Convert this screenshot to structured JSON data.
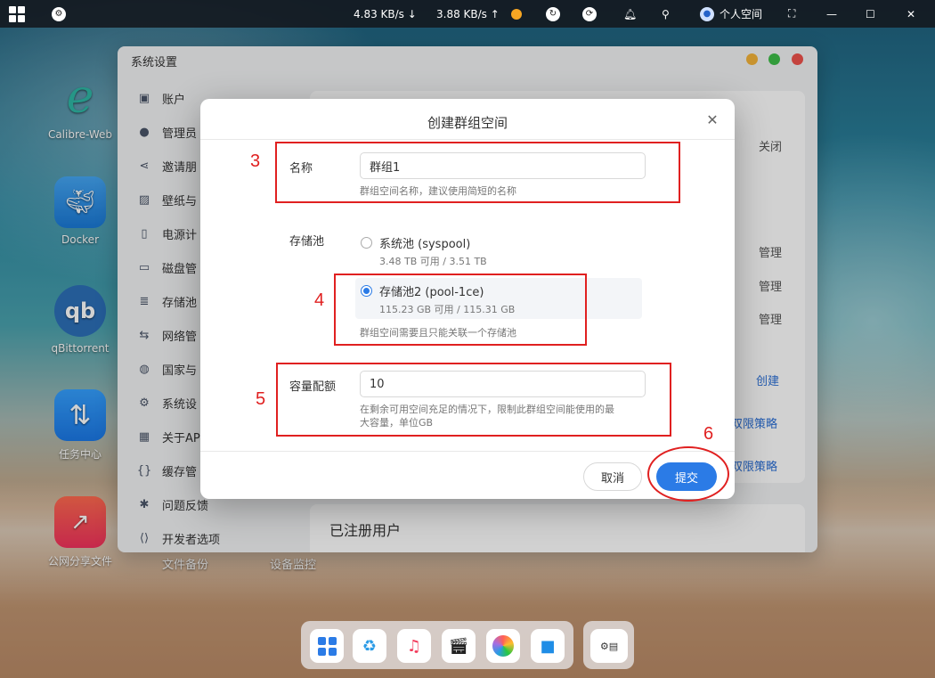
{
  "topbar": {
    "download_speed": "4.83 KB/s ↓",
    "upload_speed": "3.88 KB/s ↑",
    "user_label": "个人空间"
  },
  "desktop_icons": [
    {
      "label": "Calibre-Web",
      "icon": "calibre-e-icon"
    },
    {
      "label": "Docker",
      "icon": "whale-icon"
    },
    {
      "label": "qBittorrent",
      "icon": "qb-icon"
    },
    {
      "label": "任务中心",
      "icon": "updown-arrows-icon"
    },
    {
      "label": "公网分享文件",
      "icon": "share-arrow-icon"
    }
  ],
  "bottom_labels": [
    "文件备份",
    "设备监控"
  ],
  "settings_window": {
    "title": "系统设置",
    "sidebar": [
      "账户",
      "管理员",
      "邀请朋",
      "壁纸与",
      "电源计",
      "磁盘管",
      "存储池",
      "网络管",
      "国家与",
      "系统设",
      "关于AP",
      "缓存管",
      "问题反馈",
      "开发者选项"
    ],
    "right_texts": {
      "close": "关闭",
      "manage1": "管理",
      "manage2": "管理",
      "manage3": "管理",
      "create": "创建",
      "policy1": "双限策略",
      "policy2": "双限策略"
    },
    "registered_users": "已注册用户"
  },
  "modal": {
    "title": "创建群组空间",
    "name_label": "名称",
    "name_value": "群组1",
    "name_hint": "群组空间名称，建议使用简短的名称",
    "pool_label": "存储池",
    "pools": [
      {
        "title": "系统池 (syspool)",
        "sub": "3.48 TB 可用 / 3.51 TB",
        "selected": false
      },
      {
        "title": "存储池2 (pool-1ce)",
        "sub": "115.23 GB 可用 / 115.31 GB",
        "selected": true
      }
    ],
    "pool_hint": "群组空间需要且只能关联一个存储池",
    "quota_label": "容量配额",
    "quota_value": "10",
    "quota_hint_line1": "在剩余可用空间充足的情况下，限制此群组空间能使用的最",
    "quota_hint_line2": "大容量，单位GB",
    "cancel_label": "取消",
    "submit_label": "提交"
  },
  "annotations": [
    "3",
    "4",
    "5",
    "6"
  ],
  "colors": {
    "accent": "#2b7be6",
    "annotation": "#e02020"
  }
}
